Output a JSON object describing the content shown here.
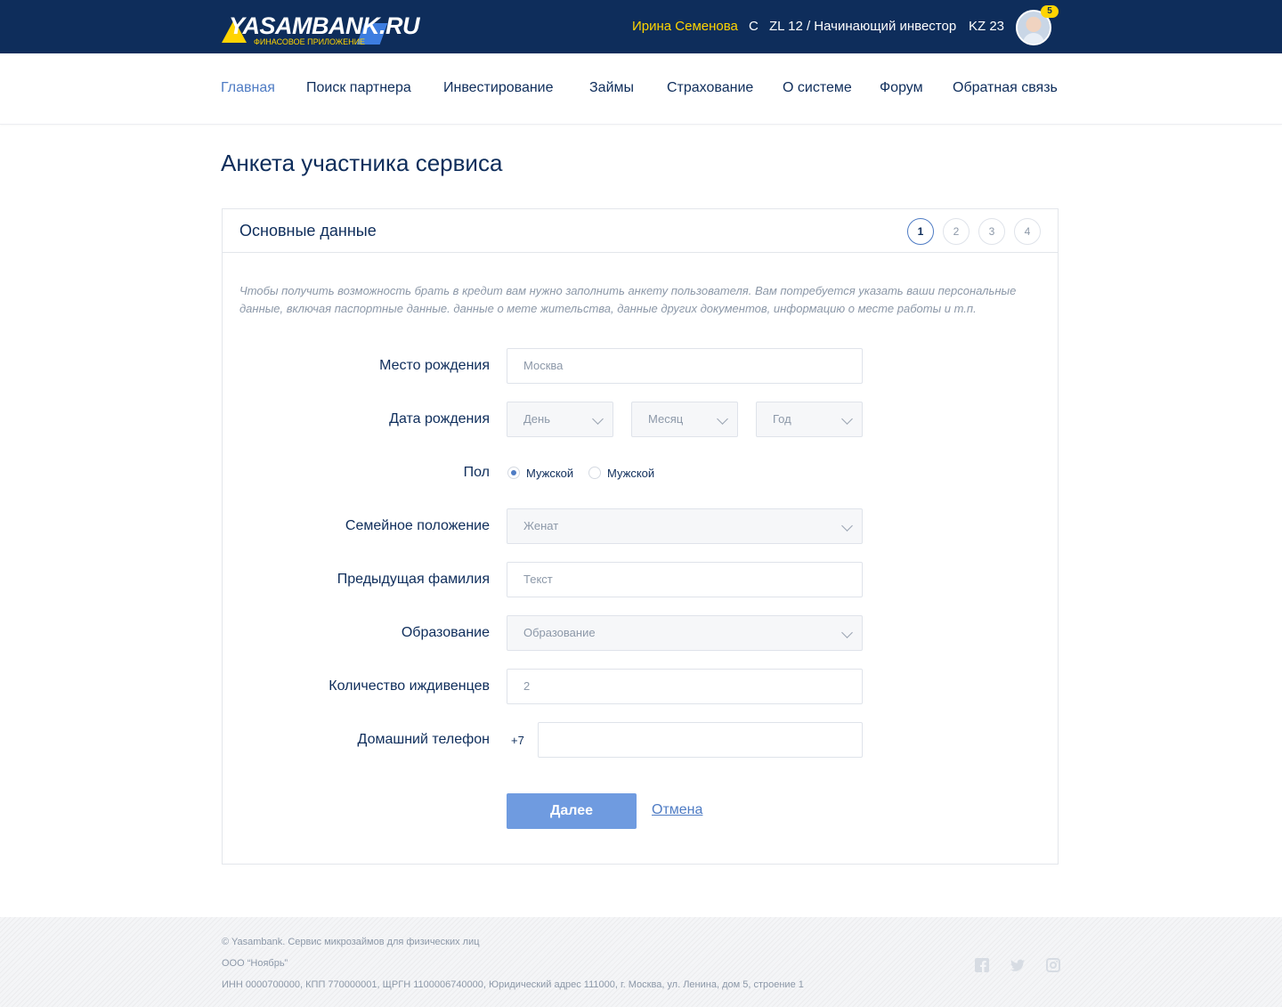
{
  "header": {
    "logo_text": "YASAMBANK.RU",
    "logo_subtitle": "ФИНАСОВОЕ ПРИЛОЖЕНИЕ",
    "user_name": "Ирина Семенова",
    "c_label": "C",
    "zl_label": "ZL 12 / Начинающий инвестор",
    "kz_label": "KZ 23",
    "notifications_count": "5"
  },
  "nav": {
    "items": [
      {
        "label": "Главная",
        "active": true
      },
      {
        "label": "Поиск партнера"
      },
      {
        "label": "Инвестирование"
      },
      {
        "label": "Займы"
      },
      {
        "label": "Страхование"
      },
      {
        "label": "О системе"
      },
      {
        "label": "Форум"
      },
      {
        "label": "Обратная связь"
      }
    ]
  },
  "page": {
    "title": "Анкета участника сервиса"
  },
  "card": {
    "title": "Основные данные",
    "steps": [
      "1",
      "2",
      "3",
      "4"
    ],
    "active_step": 1,
    "intro": "Чтобы получить возможность брать в кредит вам нужно заполнить анкету пользователя. Вам потребуется указать ваши персональные данные, включая паспортные данные. данные о мете жительства, данные других документов, информацию о месте работы и т.п."
  },
  "form": {
    "birthplace": {
      "label": "Место рождения",
      "placeholder": "Москва"
    },
    "birthdate": {
      "label": "Дата рождения",
      "day": "День",
      "month": "Месяц",
      "year": "Год"
    },
    "gender": {
      "label": "Пол",
      "option1": "Мужской",
      "option2": "Мужской",
      "selected": 1
    },
    "marital": {
      "label": "Семейное положение",
      "value": "Женат"
    },
    "prev_surname": {
      "label": "Предыдущая фамилия",
      "placeholder": "Текст"
    },
    "education": {
      "label": "Образование",
      "value": "Образование"
    },
    "dependents": {
      "label": "Количество иждивенцев",
      "value": "2"
    },
    "home_phone": {
      "label": "Домашний телефон",
      "prefix": "+7",
      "value": ""
    },
    "next_label": "Далее",
    "cancel_label": "Отмена"
  },
  "footer": {
    "line1": "© Yasambank. Сервис микрозаймов для физических лиц",
    "line2": "ООО “Ноябрь”",
    "line3": "ИНН 0000700000, КПП 770000001, ЩРГН 1100006740000, Юридический адрес 111000, г. Москва, ул. Ленина, дом 5, строение 1",
    "social_icons": [
      "facebook-icon",
      "twitter-icon",
      "instagram-icon"
    ]
  },
  "colors": {
    "header_bg": "#0e2d5b",
    "accent_yellow": "#ffd400",
    "link_blue": "#4f7cc4",
    "button_blue": "#6f9be0"
  }
}
